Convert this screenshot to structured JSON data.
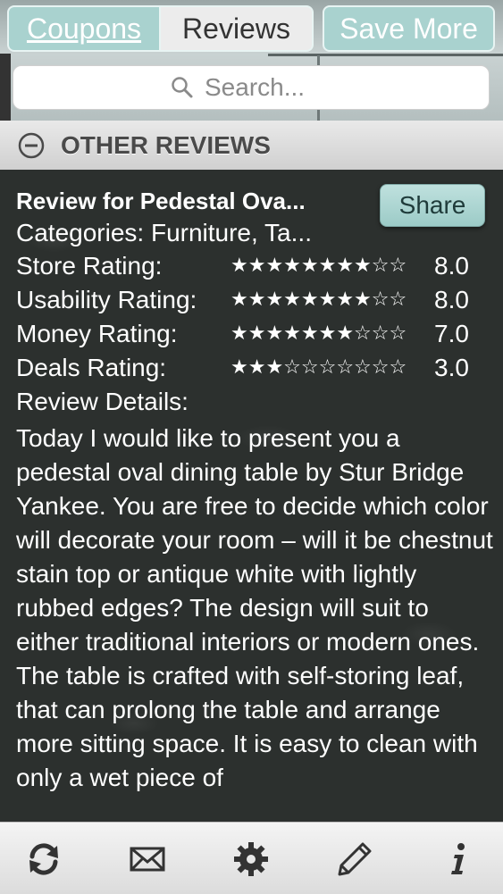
{
  "tabs": {
    "coupons": "Coupons",
    "reviews": "Reviews"
  },
  "save_more": "Save More",
  "search": {
    "placeholder": "Search..."
  },
  "section": {
    "title": "OTHER REVIEWS"
  },
  "review": {
    "title": "Review for Pedestal Ova...",
    "share_label": "Share",
    "categories": "Categories: Furniture, Ta...",
    "ratings": [
      {
        "label": "Store Rating:",
        "stars": "★★★★★★★★☆☆",
        "value": "8.0",
        "score": 8
      },
      {
        "label": "Usability Rating:",
        "stars": "★★★★★★★★☆☆",
        "value": "8.0",
        "score": 8
      },
      {
        "label": "Money Rating:",
        "stars": "★★★★★★★☆☆☆",
        "value": "7.0",
        "score": 7
      },
      {
        "label": "Deals Rating:",
        "stars": "★★★☆☆☆☆☆☆☆",
        "value": "3.0",
        "score": 3
      }
    ],
    "details_label": "Review Details:",
    "details_text": "Today I would like to present you a pedestal oval dining table by Stur Bridge Yankee. You are free to decide which color will decorate your room – will it be chestnut stain top or antique white with lightly rubbed edges? The design will suit to either traditional interiors or modern ones. The table is crafted with self-storing leaf, that can prolong the table and arrange more sitting space. It is easy to clean with only a wet piece of"
  },
  "toolbar": {
    "icons": [
      "refresh-icon",
      "mail-icon",
      "gear-icon",
      "pencil-icon",
      "info-icon"
    ]
  },
  "colors": {
    "accent": "#a9d2cf",
    "content_bg": "#2c302e",
    "header_bg": "#dcdcdc"
  }
}
